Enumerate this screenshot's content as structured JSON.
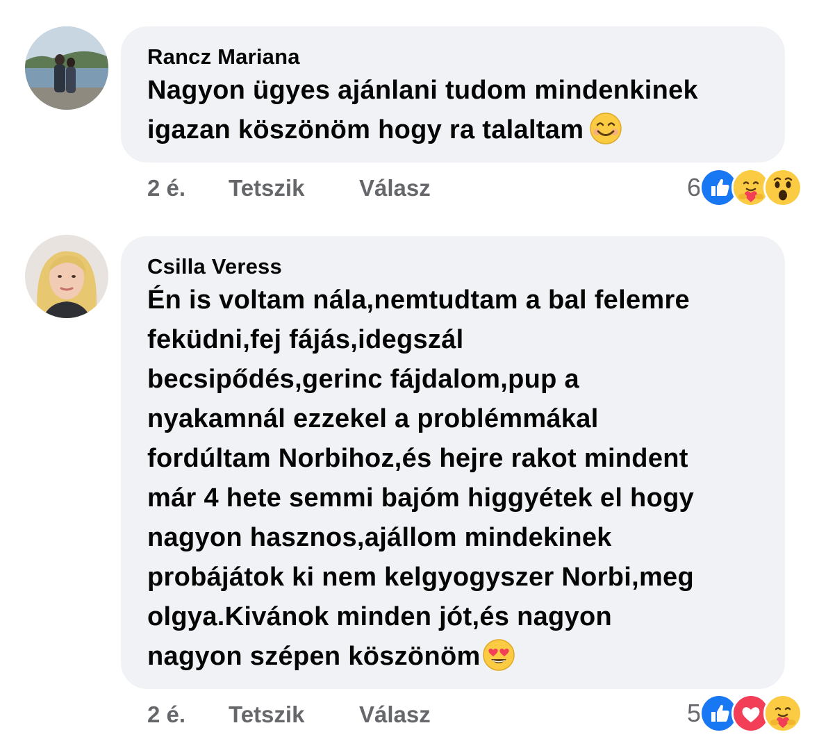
{
  "comments": [
    {
      "author": "Rancz Mariana",
      "text_lines": [
        "Nagyon ügyes ajánlani tudom mindenkinek",
        "igazan köszönöm hogy ra talaltam"
      ],
      "inline_emoji": "smiling-face-emoji",
      "time": "2 é.",
      "like_label": "Tetszik",
      "reply_label": "Válasz",
      "reaction_count": "6",
      "reactions": [
        "like",
        "care",
        "wow"
      ]
    },
    {
      "author": "Csilla Veress",
      "text_lines": [
        "Én is  voltam nála,nemtudtam a bal felemre",
        "feküdni,fej fájás,idegszál",
        "becsipődés,gerinc fájdalom,pup a",
        "nyakamnál ezzekel a problémmákal",
        "fordúltam Norbihoz,és hejre rakot mindent",
        "már 4 hete semmi bajóm higgyétek el hogy",
        "nagyon hasznos,ajállom mindekinek",
        "probájátok ki nem kelgyogyszer Norbi,meg",
        "olgya.Kivánok minden jót,és nagyon",
        "nagyon szépen köszönöm"
      ],
      "inline_emoji": "heart-eyes-emoji",
      "time": "2 é.",
      "like_label": "Tetszik",
      "reply_label": "Válasz",
      "reaction_count": "5",
      "reactions": [
        "like",
        "love",
        "care"
      ]
    }
  ],
  "colors": {
    "bubble": "#f0f2f5",
    "meta_text": "#65676b",
    "like_blue": "#1877f2",
    "love_red": "#f33e58",
    "emoji_yellow": "#fbcb43"
  }
}
